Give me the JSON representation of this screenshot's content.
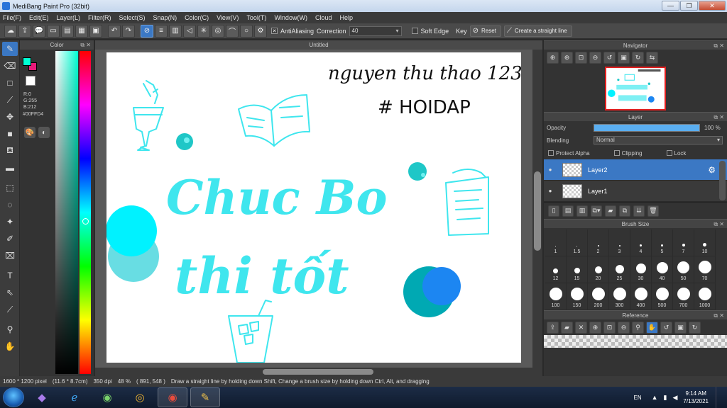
{
  "window": {
    "title": "MediBang Paint Pro (32bit)",
    "minimize": "—",
    "maximize": "❐",
    "close": "✕"
  },
  "menu": [
    "File(F)",
    "Edit(E)",
    "Layer(L)",
    "Filter(R)",
    "Select(S)",
    "Snap(N)",
    "Color(C)",
    "View(V)",
    "Tool(T)",
    "Window(W)",
    "Cloud",
    "Help"
  ],
  "toolbar": {
    "antialiasing_label": "AntiAliasing",
    "correction_label": "Correction",
    "correction_value": "40",
    "soft_edge_label": "Soft Edge",
    "key_label": "Key",
    "reset_label": "Reset",
    "straight_line_label": "Create a straight line"
  },
  "color_panel": {
    "title": "Color",
    "fg_color": "#00FFD4",
    "bg_color": "#E8197A",
    "r": "R:0",
    "g": "G:255",
    "b": "B:212",
    "hex": "#00FFD4"
  },
  "document": {
    "tab": "Untitled",
    "handwriting_name": "nguyen thu thao 123",
    "handwriting_tag": "# HOIDAP",
    "lettering_line1": "Chuc Bo",
    "lettering_line2": "thi tốt",
    "ink_color": "#3fe6ee"
  },
  "navigator": {
    "title": "Navigator"
  },
  "layer_panel": {
    "title": "Layer",
    "opacity_label": "Opacity",
    "opacity_value": "100 %",
    "opacity": 1.0,
    "blending_label": "Blending",
    "blending_value": "Normal",
    "protect_alpha": "Protect Alpha",
    "clipping": "Clipping",
    "lock": "Lock",
    "layers": [
      {
        "name": "Layer2",
        "selected": true
      },
      {
        "name": "Layer1",
        "selected": false
      }
    ]
  },
  "brush_size": {
    "title": "Brush Size",
    "sizes": [
      "1",
      "1.5",
      "2",
      "3",
      "4",
      "5",
      "7",
      "10",
      "12",
      "15",
      "20",
      "25",
      "30",
      "40",
      "50",
      "70",
      "100",
      "150",
      "200",
      "300",
      "400",
      "500",
      "700",
      "1000"
    ]
  },
  "reference": {
    "title": "Reference"
  },
  "status": {
    "size": "1600 * 1200 pixel",
    "physical": "(11.6 * 8.7cm)",
    "dpi": "350 dpi",
    "zoom": "48 %",
    "coords": "( 891, 548 )",
    "hint": "Draw a straight line by holding down Shift, Change a brush size by holding down Ctrl, Alt, and dragging"
  },
  "taskbar": {
    "language": "EN",
    "time": "9:14 AM",
    "date": "7/13/2021"
  }
}
